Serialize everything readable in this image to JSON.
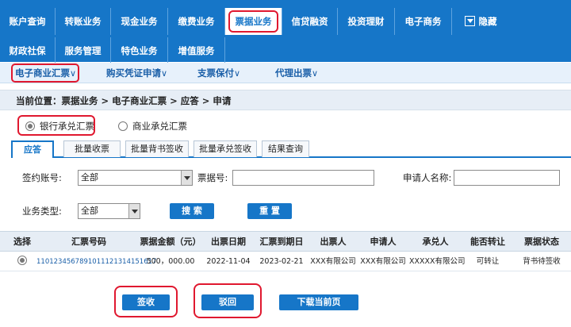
{
  "nav": {
    "row1": [
      "账户查询",
      "转账业务",
      "现金业务",
      "缴费业务",
      "票据业务",
      "信贷融资",
      "投资理财",
      "电子商务",
      "隐藏"
    ],
    "row2": [
      "财政社保",
      "服务管理",
      "特色业务",
      "增值服务"
    ]
  },
  "submenu": {
    "items": [
      "电子商业汇票",
      "购买凭证申请",
      "支票保付",
      "代理出票"
    ]
  },
  "breadcrumb": "当前位置：票据业务 > 电子商业汇票 > 应答 > 申请",
  "radios": {
    "bank": "银行承兑汇票",
    "commercial": "商业承兑汇票"
  },
  "tabs": [
    "应答",
    "批量收票",
    "批量背书签收",
    "批量承兑签收",
    "结果查询"
  ],
  "form": {
    "account_label": "签约账号:",
    "account_value": "全部",
    "bill_no_label": "票据号:",
    "applicant_label": "申请人名称:",
    "biz_type_label": "业务类型:",
    "biz_type_value": "全部",
    "search_btn": "搜 索",
    "reset_btn": "重 置"
  },
  "table": {
    "headers": [
      "选择",
      "汇票号码",
      "票据金额（元）",
      "出票日期",
      "汇票到期日",
      "出票人",
      "申请人",
      "承兑人",
      "能否转让",
      "票据状态"
    ],
    "rows": [
      [
        "",
        "110123456789101112131415161​7",
        "500，000.00",
        "2022-11-04",
        "2023-02-21",
        "XXX有限公司",
        "XXX有限公司",
        "XXXXX有限公司",
        "可转让",
        "背书待签收"
      ]
    ]
  },
  "actions": {
    "accept": "签收",
    "reject": "驳回",
    "download": "下载当前页"
  },
  "colors": {
    "primary": "#1676c8",
    "highlight": "#e0182f",
    "link": "#1a5fa8"
  }
}
